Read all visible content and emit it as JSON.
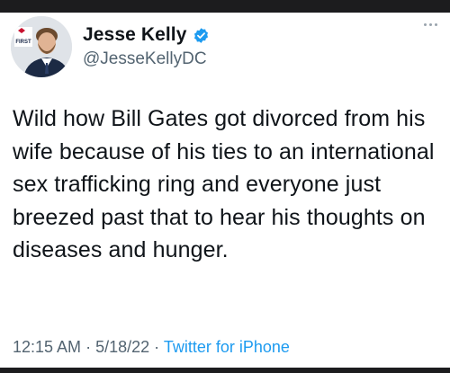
{
  "tweet": {
    "author": {
      "display_name": "Jesse Kelly",
      "handle": "@JesseKellyDC",
      "avatar_badge_text": "FIRST",
      "verified": true
    },
    "text": "Wild how Bill Gates got divorced from his wife because of his ties to an international sex trafficking ring and everyone just breezed past that to hear his thoughts on diseases and hunger.",
    "time": "12:15 AM",
    "separator": "·",
    "date": "5/18/22",
    "source": "Twitter for iPhone"
  },
  "icons": {
    "verified": "verified-badge-icon",
    "more": "more-options-icon"
  },
  "colors": {
    "accent": "#1d9bf0",
    "text_primary": "#0f1419",
    "text_secondary": "#536471"
  }
}
